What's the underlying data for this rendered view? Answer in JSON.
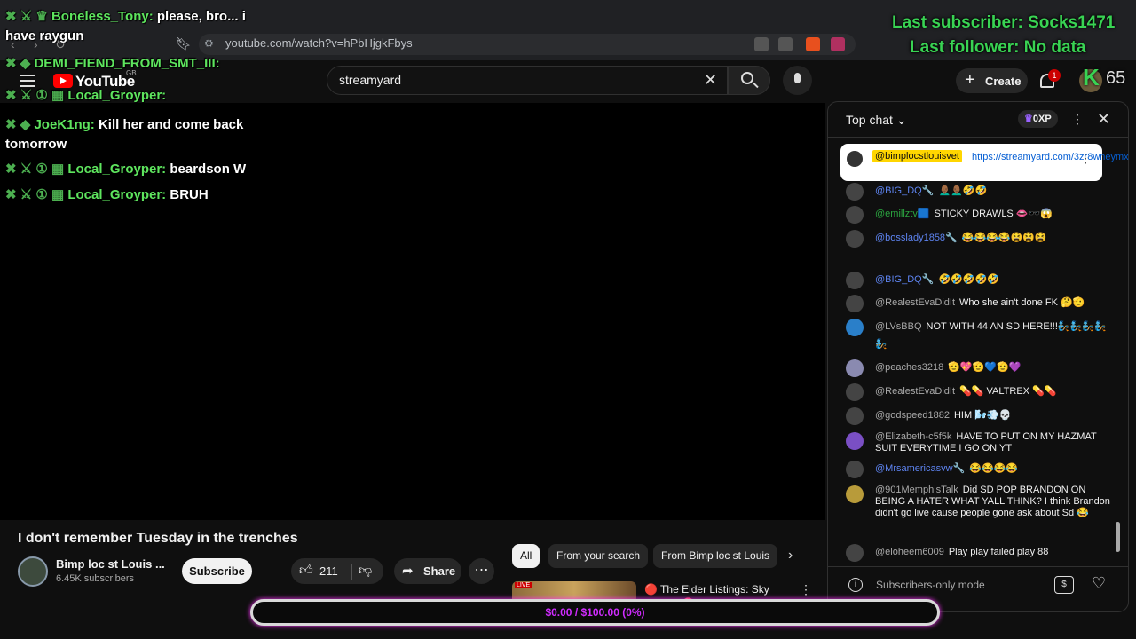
{
  "browser": {
    "url": "youtube.com/watch?v=hPbHjgkFbys"
  },
  "header": {
    "logo_text": "YouTube",
    "region": "GB",
    "search_value": "streamyard",
    "create_label": "Create",
    "notification_count": "1"
  },
  "video": {
    "title": "I don't remember Tuesday in the trenches",
    "channel_name": "Bimp loc st Louis ...",
    "subscribers": "6.45K subscribers",
    "subscribe_label": "Subscribe",
    "like_count": "211",
    "share_label": "Share"
  },
  "chips": [
    {
      "label": "All"
    },
    {
      "label": "From your search"
    },
    {
      "label": "From Bimp loc st Louis"
    }
  ],
  "recommendation": {
    "title": "🔴 The Elder Listings: Sky Realtor 🔴 Scuffed Realtor"
  },
  "chat": {
    "header_label": "Top chat ⌄",
    "xp": "0XP",
    "pinned": {
      "author": "@bimplocstlouisvet",
      "text": "https://streamyard.com/3zr8wneymx"
    },
    "messages": [
      {
        "author": "@BIG_DQ🔧",
        "text": "👨🏾‍🦲👨🏾‍🦲🤣🤣"
      },
      {
        "author": "@emillztv🟦",
        "text": "STICKY DRAWLS 👄🕶️😱"
      },
      {
        "author": "@bosslady1858🔧",
        "text": "😂😂😂😂😫😫😫"
      },
      {
        "author": "@BIG_DQ🔧",
        "text": "🤣🤣🤣🤣🤣"
      },
      {
        "author": "@RealestEvaDidIt",
        "text": "Who she ain't done FK 🤔🫡"
      },
      {
        "author": "@LVsBBQ",
        "text": "NOT WITH 44 AN SD HERE!!!🧞🧞🧞🧞🧞"
      },
      {
        "author": "@peaches3218",
        "text": "🫡💖🫡💙🫡💜"
      },
      {
        "author": "@RealestEvaDidIt",
        "text": "💊💊 VALTREX 💊💊"
      },
      {
        "author": "@godspeed1882",
        "text": "HIM 🌬️💨💀"
      },
      {
        "author": "@Elizabeth-c5f5k",
        "text": "HAVE TO PUT ON MY HAZMAT SUIT EVERYTIME I GO ON YT"
      },
      {
        "author": "@Mrsamericasvw🔧",
        "text": "😂😂😂😂"
      },
      {
        "author": "@901MemphisTalk",
        "text": "Did SD POP BRANDON ON BEING A HATER WHAT YALL THINK? I think Brandon didn't go live cause people gone ask about Sd 😂"
      },
      {
        "author": "@eloheem6009",
        "text": "Play play failed play 88"
      }
    ],
    "footer_label": "Subscribers-only mode"
  },
  "overlay_chat": [
    {
      "name": "Boneless_Tony:",
      "text": "please, bro... i have raygun"
    },
    {
      "name": "DEMI_FIEND_FROM_SMT_III:",
      "text": ""
    },
    {
      "name": "Local_Groyper:",
      "text": ""
    },
    {
      "name": "JoeK1ng:",
      "text": "Kill her and come back tomorrow"
    },
    {
      "name": "Local_Groyper:",
      "text": "beardson W"
    },
    {
      "name": "Local_Groyper:",
      "text": "BRUH"
    }
  ],
  "stream_overlay": {
    "last_subscriber": "Last subscriber: Socks1471",
    "last_follower": "Last follower: No data",
    "k_count": "65"
  },
  "goal": {
    "text": "$0.00 / $100.00 (0%)",
    "progress_fraction": 0
  },
  "colors": {
    "accent_red": "#ff0000",
    "overlay_green": "#39d353",
    "goal_purple": "#d02cff",
    "mod_blue": "#5e84f1"
  }
}
